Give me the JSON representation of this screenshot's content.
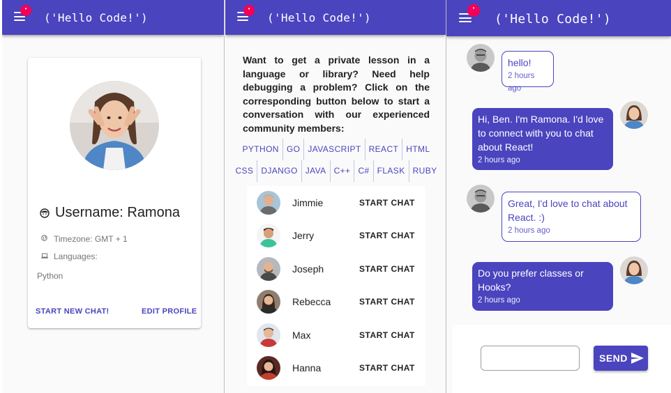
{
  "app": {
    "title": "('Hello Code!')",
    "notification_badge": "•",
    "brand_color": "#4a44bf",
    "badge_color": "#f50057"
  },
  "profile": {
    "username": "Username: Ramona",
    "timezone": "Timezone: GMT + 1",
    "languages_label": "Languages:",
    "languages_value": "Python",
    "start_new_chat": "START NEW CHAT!",
    "edit_profile": "EDIT PROFILE"
  },
  "directory": {
    "intro": "Want to get a private lesson in a language or library? Need help debugging a problem? Click on the corresponding button below to start a conversation with our experienced community members:",
    "languages_row1": [
      "PYTHON",
      "GO",
      "JAVASCRIPT",
      "REACT",
      "HTML"
    ],
    "languages_row2": [
      "CSS",
      "DJANGO",
      "JAVA",
      "C++",
      "C#",
      "FLASK",
      "RUBY"
    ],
    "users": [
      {
        "name": "Jimmie",
        "action": "START CHAT"
      },
      {
        "name": "Jerry",
        "action": "START CHAT"
      },
      {
        "name": "Joseph",
        "action": "START CHAT"
      },
      {
        "name": "Rebecca",
        "action": "START CHAT"
      },
      {
        "name": "Max",
        "action": "START CHAT"
      },
      {
        "name": "Hanna",
        "action": "START CHAT"
      }
    ]
  },
  "chat": {
    "messages": [
      {
        "direction": "incoming",
        "text": "hello!",
        "time": "2 hours ago"
      },
      {
        "direction": "outgoing",
        "text": "Hi, Ben. I'm Ramona. I'd love to connect with you to chat about React!",
        "time": "2 hours ago"
      },
      {
        "direction": "incoming",
        "text": "Great, I'd love to chat about React. :)",
        "time": "2 hours ago"
      },
      {
        "direction": "outgoing",
        "text": "Do you prefer classes or Hooks?",
        "time": "2 hours ago"
      }
    ],
    "input_value": "",
    "send_label": "SEND"
  }
}
